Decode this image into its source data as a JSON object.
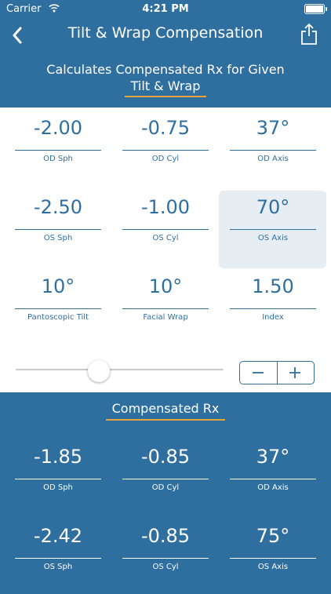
{
  "status": {
    "carrier": "Carrier",
    "time": "4:21 PM"
  },
  "nav": {
    "title": "Tilt & Wrap Compensation"
  },
  "subtitle": {
    "line1": "Calculates Compensated Rx for Given",
    "line2": "Tilt  & Wrap"
  },
  "inputs": [
    {
      "value": "-2.00",
      "label": "OD Sph"
    },
    {
      "value": "-0.75",
      "label": "OD Cyl"
    },
    {
      "value": "37°",
      "label": "OD Axis"
    },
    {
      "value": "-2.50",
      "label": "OS Sph"
    },
    {
      "value": "-1.00",
      "label": "OS Cyl"
    },
    {
      "value": "70°",
      "label": "OS Axis"
    },
    {
      "value": "10°",
      "label": "Pantoscopic Tilt"
    },
    {
      "value": "10°",
      "label": "Facial Wrap"
    },
    {
      "value": "1.50",
      "label": "Index"
    }
  ],
  "slider": {
    "level": 0.4
  },
  "result": {
    "title": "Compensated Rx",
    "items": [
      {
        "value": "-1.85",
        "label": "OD Sph"
      },
      {
        "value": "-0.85",
        "label": "OD Cyl"
      },
      {
        "value": "37°",
        "label": "OD Axis"
      },
      {
        "value": "-2.42",
        "label": "OS Sph"
      },
      {
        "value": "-0.85",
        "label": "OS Cyl"
      },
      {
        "value": "75°",
        "label": "OS Axis"
      }
    ]
  },
  "colors": {
    "primary": "#2f6fa0",
    "accent": "#e8a33d",
    "selected": "#e6eef3"
  }
}
